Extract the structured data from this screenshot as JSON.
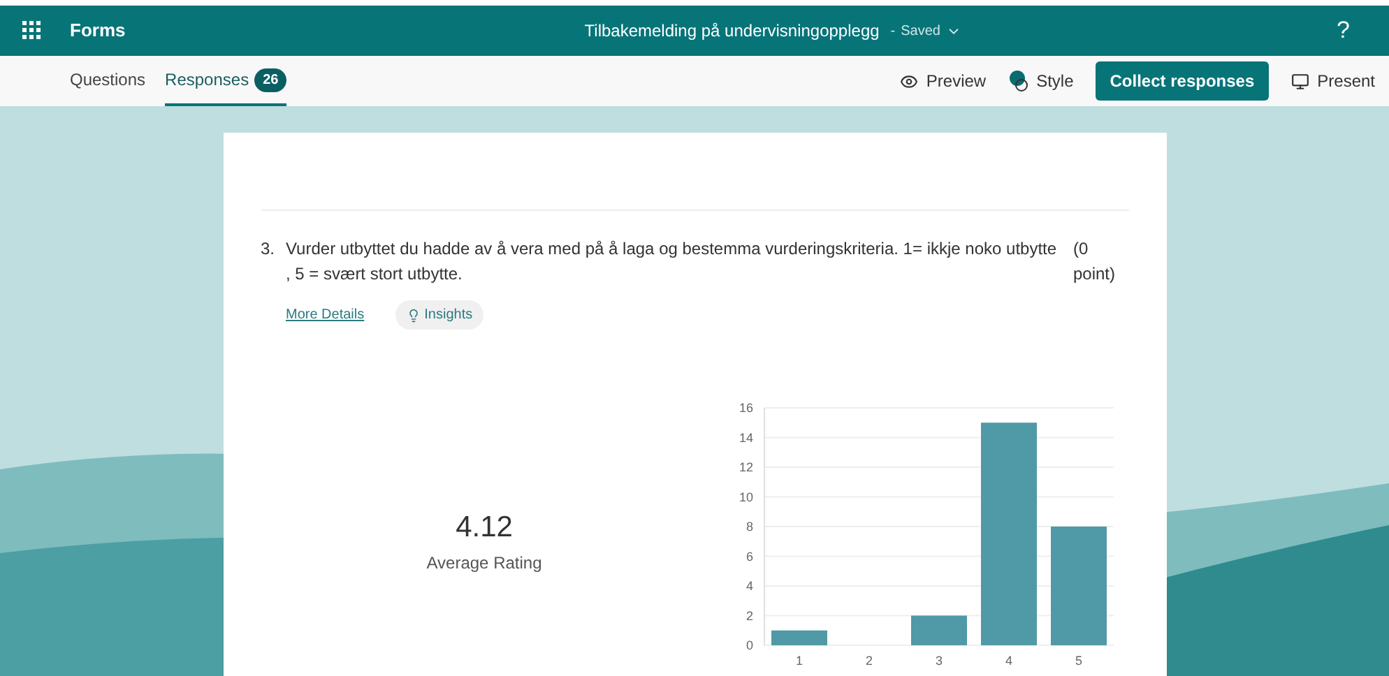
{
  "app": {
    "name": "Forms",
    "title": "Tilbakemelding på undervisningopplegg",
    "separator": "-",
    "save_status": "Saved",
    "help": "?"
  },
  "tabs": [
    {
      "label": "Questions",
      "selected": false
    },
    {
      "label": "Responses",
      "selected": true,
      "badge": "26"
    }
  ],
  "toolbar": {
    "preview": "Preview",
    "style": "Style",
    "collect": "Collect responses",
    "present": "Present"
  },
  "question": {
    "number": "3.",
    "text": "Vurder utbyttet du hadde av å vera med på å laga og bestemma vurderingskriteria. 1= ikkje noko utbytte , 5 = svært stort utbytte.",
    "points": "(0 point)",
    "more_details": "More Details",
    "insights": "Insights"
  },
  "summary": {
    "value": "4.12",
    "label": "Average Rating"
  },
  "chart_data": {
    "type": "bar",
    "categories": [
      "1",
      "2",
      "3",
      "4",
      "5"
    ],
    "values": [
      1,
      0,
      2,
      15,
      8
    ],
    "ylim": [
      0,
      16
    ],
    "yticks": [
      0,
      2,
      4,
      6,
      8,
      10,
      12,
      14,
      16
    ],
    "grid": true
  }
}
